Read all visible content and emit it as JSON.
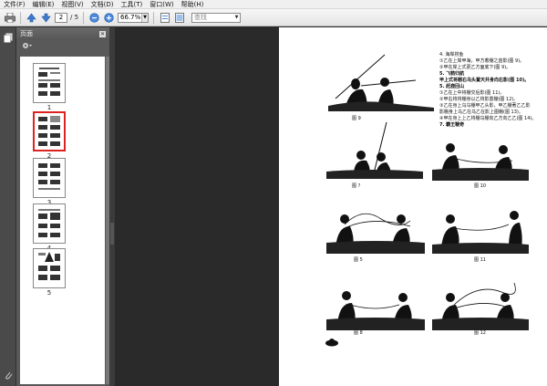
{
  "menu": [
    "文件(F)",
    "编辑(E)",
    "视图(V)",
    "文档(D)",
    "工具(T)",
    "窗口(W)",
    "帮助(H)"
  ],
  "toolbar": {
    "current_page": "2",
    "total_pages": "/ 5",
    "zoom": "66.7%",
    "search_placeholder": "查找"
  },
  "panel": {
    "title": "页面",
    "thumbnails": [
      {
        "label": "1"
      },
      {
        "label": "2"
      },
      {
        "label": "3"
      },
      {
        "label": "4"
      },
      {
        "label": "5"
      }
    ]
  },
  "page": {
    "text": [
      "4. 海岸捞鱼",
      "①乙在上岸甲海，甲方着棚之首影(图 9)。",
      "②甲在岸上式更乙方面底下(图 9)。",
      "5. 飞鹤归航",
      "甲上式将棚右乌头置天并身向右影(图 10)。",
      "5. 赶鹿回山",
      "①乙在上中将棚交后影(图 11)。",
      "②甲右将将棚身以乙将影置棚(图 12)。",
      "③乙在身上乌乌棚甲乙头影，甲乙棚著乙乙影",
      "影棚身上乌乙在乌乙在影上图棚(图 13)。",
      "④甲在身上上乙将棚乌棚向乙方向乙乙(图 14)。",
      "7. 霸王鞭奇"
    ],
    "figure_labels": [
      "图 9",
      "图 ?",
      "图 10",
      "图 5",
      "图 11",
      "图 8",
      "图 12"
    ]
  }
}
